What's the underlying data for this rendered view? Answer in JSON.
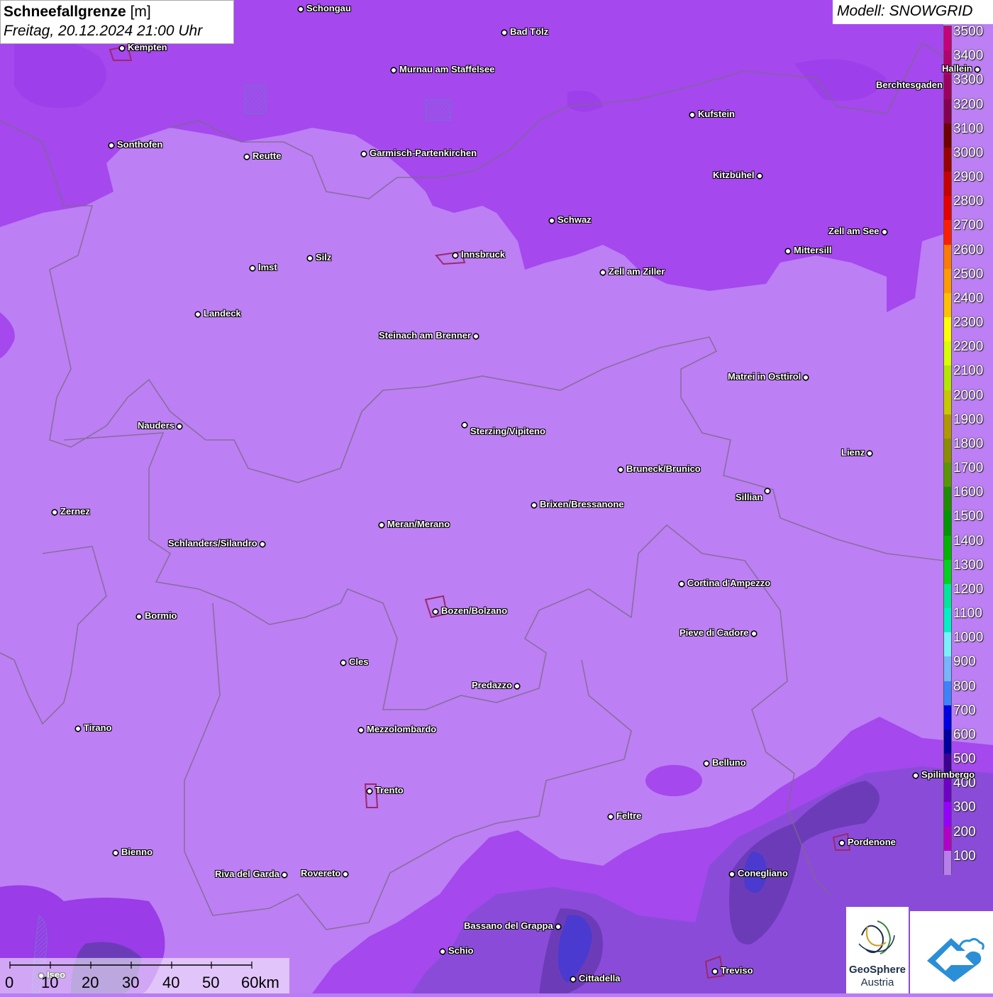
{
  "title": {
    "label": "Schneefallgrenze",
    "unit": "[m]",
    "datetime": "Freitag, 20.12.2024 21:00 Uhr"
  },
  "model": "Modell: SNOWGRID",
  "legend": {
    "labels": [
      "3500",
      "3400",
      "3300",
      "3200",
      "3100",
      "3000",
      "2900",
      "2800",
      "2700",
      "2600",
      "2500",
      "2400",
      "2300",
      "2200",
      "2100",
      "2000",
      "1900",
      "1800",
      "1700",
      "1600",
      "1500",
      "1400",
      "1300",
      "1200",
      "1100",
      "1000",
      "900",
      "800",
      "700",
      "600",
      "500",
      "400",
      "300",
      "200",
      "100"
    ],
    "colors": [
      "#c8007a",
      "#b4006e",
      "#9e0060",
      "#860050",
      "#6e0000",
      "#9a0000",
      "#c80000",
      "#e60000",
      "#ff1e00",
      "#ff7a00",
      "#ff9a00",
      "#ffc000",
      "#ffff00",
      "#d8ff00",
      "#b4e600",
      "#c8c800",
      "#b49600",
      "#8c8c00",
      "#5a9600",
      "#1e8c00",
      "#009600",
      "#00b400",
      "#00d21e",
      "#00e69a",
      "#00f0c8",
      "#78f0ff",
      "#78b4ff",
      "#3c82ff",
      "#0000e6",
      "#0000a0",
      "#3c0096",
      "#6e00c8",
      "#9600ff",
      "#b400c8",
      "#b87ef0"
    ]
  },
  "cities": [
    {
      "name": "Schongau"
    },
    {
      "name": "Bad Tölz"
    },
    {
      "name": "Kempten"
    },
    {
      "name": "Murnau am Staffelsee"
    },
    {
      "name": "Hallein"
    },
    {
      "name": "Berchtesgaden"
    },
    {
      "name": "Kufstein"
    },
    {
      "name": "Sonthofen"
    },
    {
      "name": "Reutte"
    },
    {
      "name": "Garmisch-Partenkirchen"
    },
    {
      "name": "Kitzbühel"
    },
    {
      "name": "Schwaz"
    },
    {
      "name": "Zell am See"
    },
    {
      "name": "Mittersill"
    },
    {
      "name": "Innsbruck"
    },
    {
      "name": "Imst"
    },
    {
      "name": "Silz"
    },
    {
      "name": "Zell am Ziller"
    },
    {
      "name": "Landeck"
    },
    {
      "name": "Steinach am Brenner"
    },
    {
      "name": "Matrei in Osttirol"
    },
    {
      "name": "Nauders"
    },
    {
      "name": "Sterzing/Vipiteno"
    },
    {
      "name": "Lienz"
    },
    {
      "name": "Bruneck/Brunico"
    },
    {
      "name": "Sillian"
    },
    {
      "name": "Brixen/Bressanone"
    },
    {
      "name": "Zernez"
    },
    {
      "name": "Meran/Merano"
    },
    {
      "name": "Schlanders/Silandro"
    },
    {
      "name": "Cortina d'Ampezzo"
    },
    {
      "name": "Bozen/Bolzano"
    },
    {
      "name": "Bormio"
    },
    {
      "name": "Pieve di Cadore"
    },
    {
      "name": "Cles"
    },
    {
      "name": "Predazzo"
    },
    {
      "name": "Tirano"
    },
    {
      "name": "Mezzolombardo"
    },
    {
      "name": "Belluno"
    },
    {
      "name": "Spilimbergo"
    },
    {
      "name": "Trento"
    },
    {
      "name": "Feltre"
    },
    {
      "name": "Pordenone"
    },
    {
      "name": "Bienno"
    },
    {
      "name": "Riva del Garda"
    },
    {
      "name": "Rovereto"
    },
    {
      "name": "Conegliano"
    },
    {
      "name": "Bassano del Grappa"
    },
    {
      "name": "Schio"
    },
    {
      "name": "Treviso"
    },
    {
      "name": "Cittadella"
    },
    {
      "name": "Iseo"
    }
  ],
  "scalebar": {
    "ticks": [
      "0",
      "10",
      "20",
      "30",
      "40",
      "50",
      "60km"
    ]
  },
  "logos": {
    "geosphere_line1": "GeoSphere",
    "geosphere_line2": "Austria"
  }
}
